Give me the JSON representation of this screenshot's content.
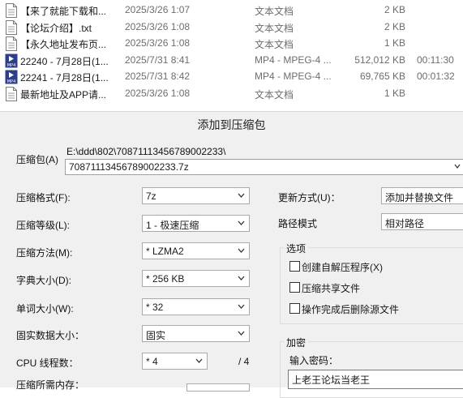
{
  "files": [
    {
      "icon": "text-file-icon",
      "name": "【来了就能下载和...",
      "date": "2025/3/26 1:07",
      "type": "文本文档",
      "size": "2 KB",
      "duration": ""
    },
    {
      "icon": "text-file-icon",
      "name": "【论坛介绍】.txt",
      "date": "2025/3/26 1:08",
      "type": "文本文档",
      "size": "2 KB",
      "duration": ""
    },
    {
      "icon": "text-file-icon",
      "name": "【永久地址发布页...",
      "date": "2025/3/26 1:08",
      "type": "文本文档",
      "size": "1 KB",
      "duration": ""
    },
    {
      "icon": "mp4-file-icon",
      "name": "22240 - 7月28日(1...",
      "date": "2025/7/31 8:41",
      "type": "MP4 - MPEG-4 ...",
      "size": "512,012 KB",
      "duration": "00:11:30"
    },
    {
      "icon": "mp4-file-icon",
      "name": "22241 - 7月28日(1...",
      "date": "2025/7/31 8:42",
      "type": "MP4 - MPEG-4 ...",
      "size": "69,765 KB",
      "duration": "00:01:32"
    },
    {
      "icon": "text-file-icon",
      "name": "最新地址及APP请...",
      "date": "2025/3/26 1:08",
      "type": "文本文档",
      "size": "1 KB",
      "duration": ""
    }
  ],
  "dialog": {
    "title": "添加到压缩包",
    "archive_label": "压缩包(A)",
    "archive_path": "E:\\ddd\\802\\70871113456789002233\\",
    "archive_name": "70871113456789002233.7z",
    "format_label": "压缩格式(F):",
    "format_value": "7z",
    "level_label": "压缩等级(L):",
    "level_value": "1 - 极速压缩",
    "method_label": "压缩方法(M):",
    "method_value": "* LZMA2",
    "dict_label": "字典大小(D):",
    "dict_value": "* 256 KB",
    "word_label": "单词大小(W):",
    "word_value": "* 32",
    "solid_label": "固实数据大小：",
    "solid_value": "固实",
    "cpu_label": "CPU 线程数：",
    "cpu_value": "* 4",
    "cpu_total": "/ 4",
    "memory_label": "压缩所需内存：",
    "update_label": "更新方式(U)：",
    "update_value": "添加并替换文件",
    "pathmode_label": "路径模式",
    "pathmode_value": "相对路径",
    "options_title": "选项",
    "options": [
      "创建自解压程序(X)",
      "压缩共享文件",
      "操作完成后删除源文件"
    ],
    "encrypt_title": "加密",
    "password_label": "输入密码：",
    "password_value": "上老王论坛当老王"
  }
}
